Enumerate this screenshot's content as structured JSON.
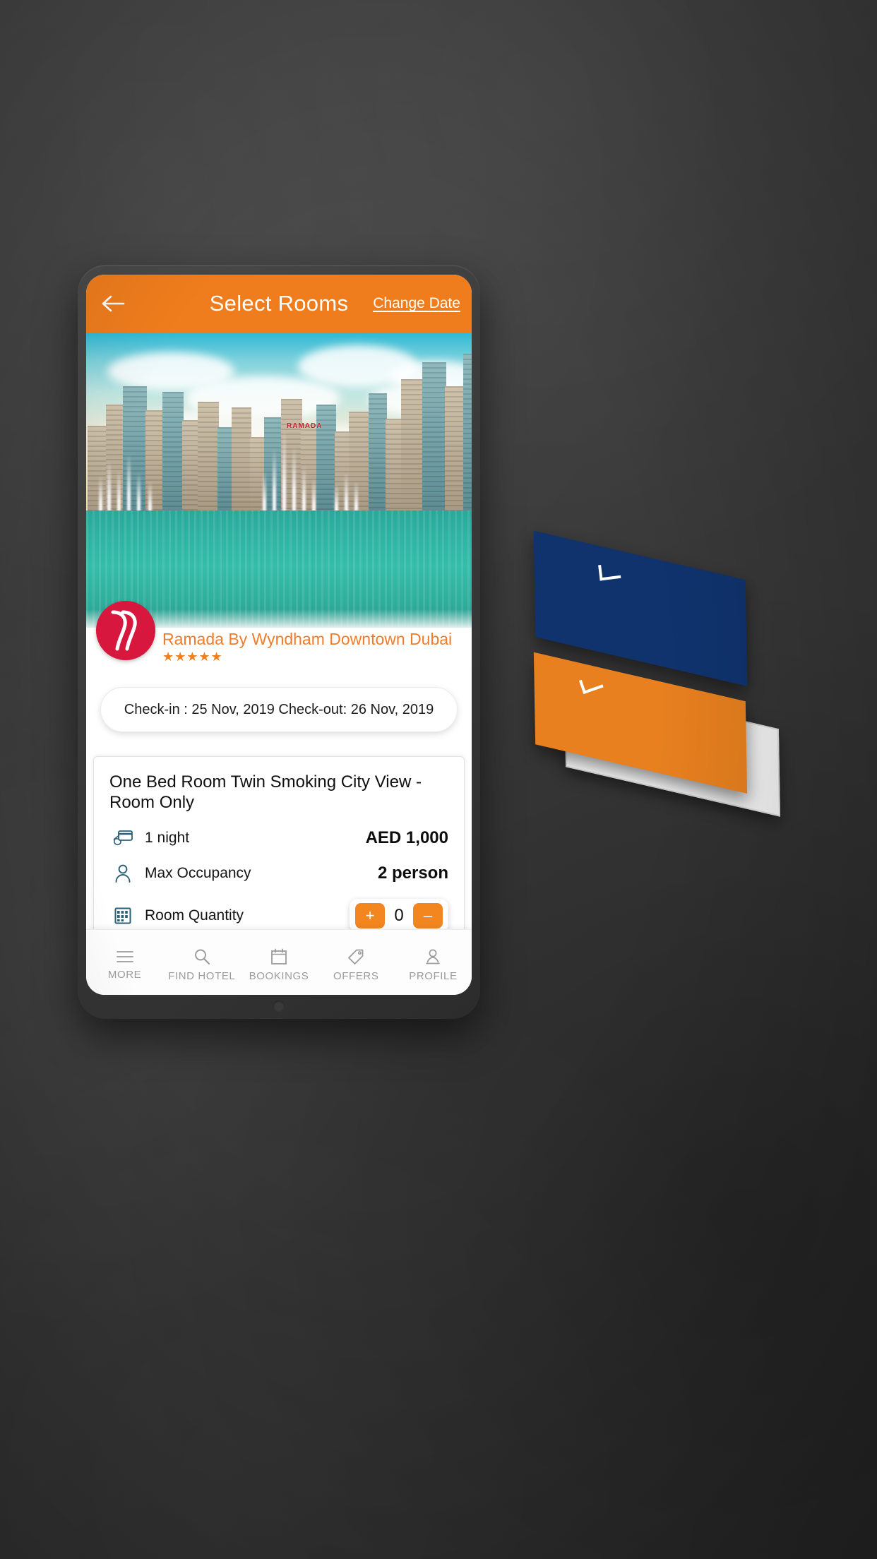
{
  "header": {
    "title": "Select Rooms",
    "back_icon": "arrow-left-icon",
    "change_date_label": "Change Date"
  },
  "hero": {
    "sign_text": "RAMADA"
  },
  "hotel": {
    "logo_icon": "ramada-logo-icon",
    "name": "Ramada By Wyndham Downtown Dubai",
    "stars": "★★★★★",
    "star_count": 5
  },
  "dates": {
    "pill_text": "Check-in : 25 Nov, 2019 Check-out: 26 Nov, 2019",
    "check_in": "25 Nov, 2019",
    "check_out": "26 Nov, 2019"
  },
  "room": {
    "title": "One Bed Room Twin Smoking City View - Room Only",
    "rows": [
      {
        "icon": "night-card-icon",
        "label": "1 night",
        "value": "AED 1,000"
      },
      {
        "icon": "person-icon",
        "label": "Max Occupancy",
        "value": "2 person"
      },
      {
        "icon": "abacus-icon",
        "label": "Room Quantity",
        "value": ""
      }
    ],
    "quantity": {
      "value": "0",
      "increase_label": "+",
      "decrease_label": "–"
    }
  },
  "bottom_nav": {
    "items": [
      {
        "icon": "hamburger-icon",
        "label": "MORE"
      },
      {
        "icon": "search-icon",
        "label": "FIND HOTEL"
      },
      {
        "icon": "calendar-icon",
        "label": "BOOKINGS"
      },
      {
        "icon": "tag-icon",
        "label": "OFFERS"
      },
      {
        "icon": "profile-icon",
        "label": "PROFILE"
      }
    ]
  },
  "colors": {
    "brand_orange": "#f07d1d",
    "hotel_name_orange": "#ef7c2a",
    "logo_red": "#d8173f",
    "nav_label_gray": "#9b9b9b",
    "icon_blue": "#2b5f77",
    "background": "#3b3b3b",
    "card_blue": "#10336e",
    "card_orange": "#e8801f"
  }
}
